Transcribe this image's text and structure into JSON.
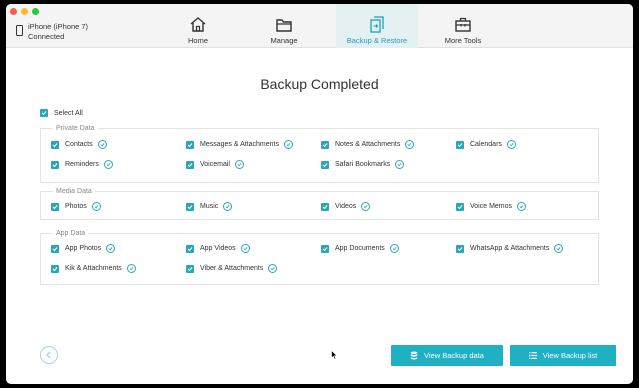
{
  "device": {
    "name": "iPhone (iPhone 7)",
    "status": "Connected",
    "icon": "phone-icon"
  },
  "nav": [
    {
      "label": "Home",
      "icon": "home-icon"
    },
    {
      "label": "Manage",
      "icon": "folder-icon"
    },
    {
      "label": "Backup & Restore",
      "icon": "backup-restore-icon",
      "active": true
    },
    {
      "label": "More Tools",
      "icon": "toolbox-icon"
    }
  ],
  "main": {
    "title": "Backup Completed",
    "select_all": "Select All",
    "groups": [
      {
        "label": "Private Data",
        "items": [
          "Contacts",
          "Messages & Attachments",
          "Notes & Attachments",
          "Calendars",
          "Reminders",
          "Voicemail",
          "Safari Bookmarks"
        ]
      },
      {
        "label": "Media Data",
        "items": [
          "Photos",
          "Music",
          "Videos",
          "Voice Memos"
        ]
      },
      {
        "label": "App Data",
        "items": [
          "App Photos",
          "App Videos",
          "App Documents",
          "WhatsApp & Attachments",
          "Kik & Attachments",
          "Viber & Attachments"
        ]
      }
    ]
  },
  "footer": {
    "back_icon": "back-arrow-icon",
    "view_data": "View Backup data",
    "view_list": "View Backup list"
  },
  "colors": {
    "accent": "#1fb0c3",
    "nav_active_bg": "#e5f0f3"
  }
}
